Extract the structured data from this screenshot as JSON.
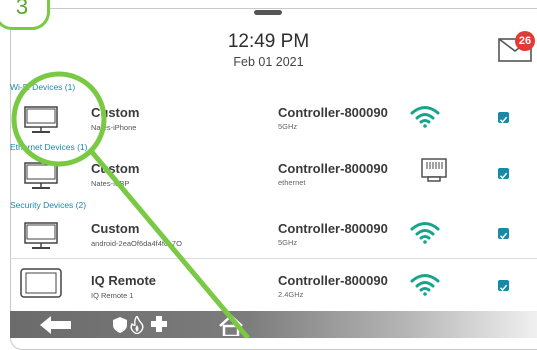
{
  "step_number": "3",
  "header": {
    "time": "12:49 PM",
    "date": "Feb 01 2021"
  },
  "notifications": {
    "count": "26"
  },
  "sections": {
    "wifi": "Wi-Fi Devices (1)",
    "ethernet": "Ethernet Devices (1)",
    "security": "Security Devices (2)"
  },
  "devices": [
    {
      "name": "Custom",
      "sub": "Nates-iPhone",
      "controller": "Controller-800090",
      "band": "5GHz",
      "connection": "wifi-icon"
    },
    {
      "name": "Custom",
      "sub": "Nates-MBP",
      "controller": "Controller-800090",
      "band": "ethernet",
      "connection": "ethernet-port-icon"
    },
    {
      "name": "Custom",
      "sub": "android-2eaOf6da4f4fca7O",
      "controller": "Controller-800090",
      "band": "5GHz",
      "connection": "wifi-icon"
    },
    {
      "name": "IQ Remote",
      "sub": "IQ Remote 1",
      "controller": "Controller-800090",
      "band": "2.4GHz",
      "connection": "wifi-icon"
    }
  ],
  "colors": {
    "accent": "#1a89a8",
    "wifi": "#17a589",
    "highlight": "#7ac943",
    "badge": "#e53935"
  },
  "bottom_bar": {
    "icons": [
      "back-arrow-icon",
      "shield-icon",
      "fire-icon",
      "medical-cross-icon",
      "home-icon"
    ]
  }
}
